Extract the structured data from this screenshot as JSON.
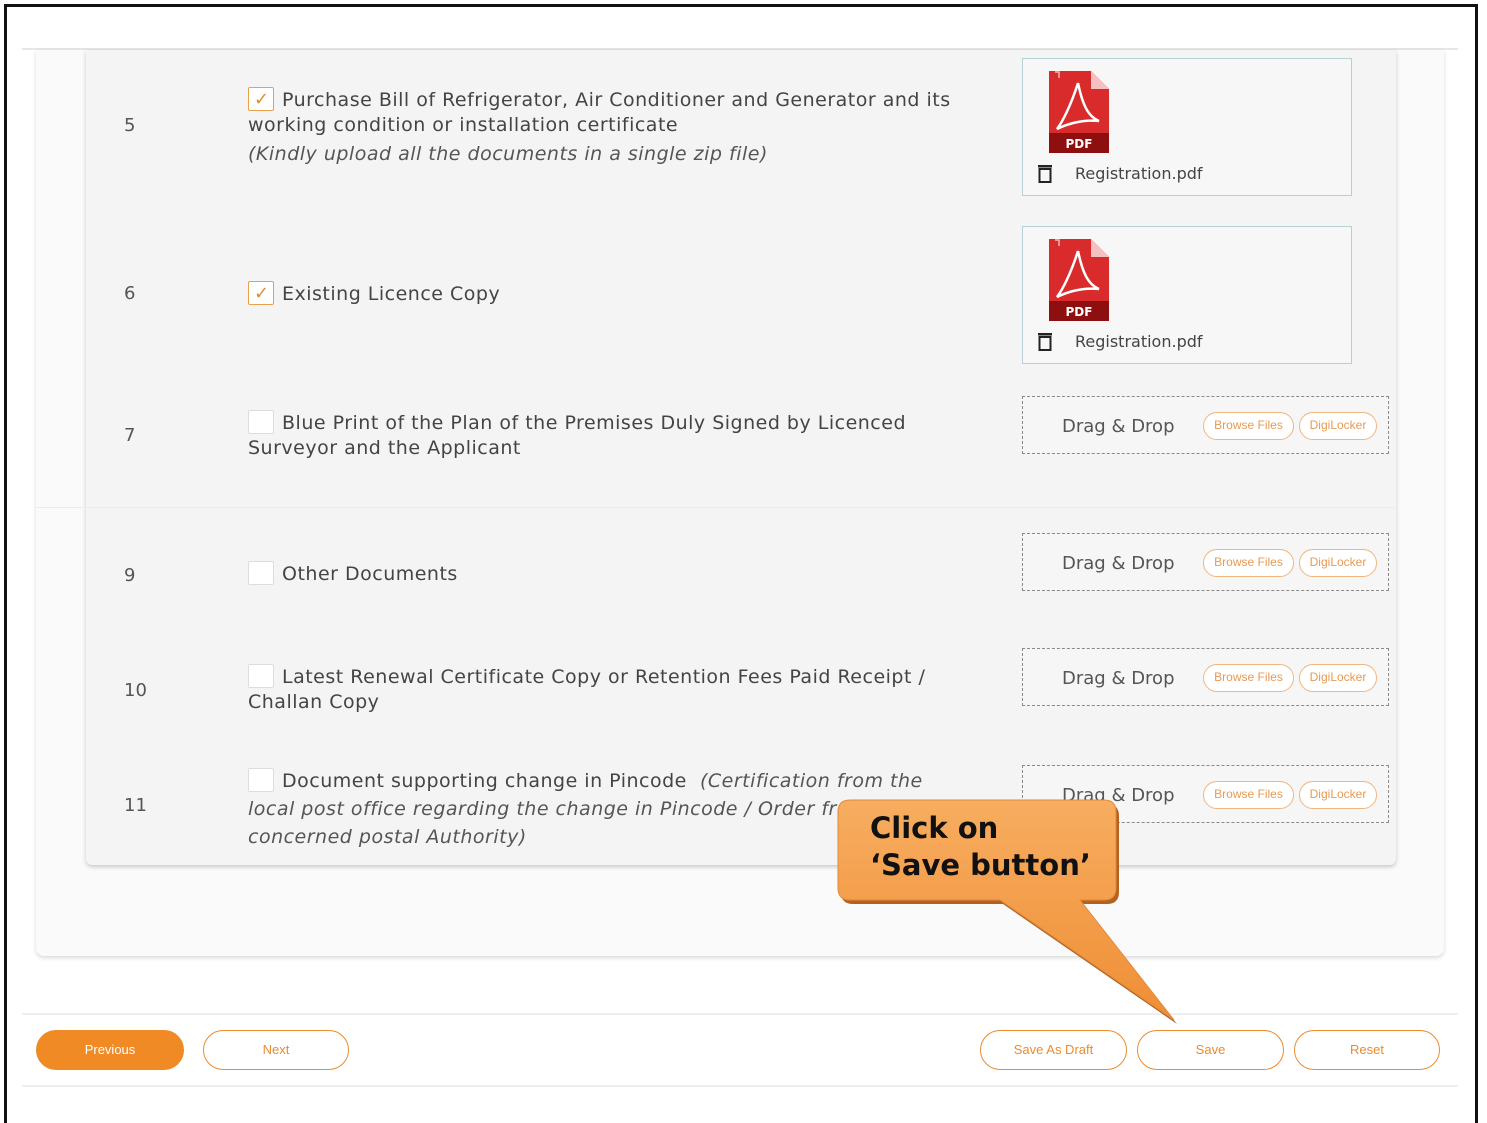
{
  "documents": [
    {
      "number": "5",
      "label": "Purchase Bill of Refrigerator, Air Conditioner and Generator and its working condition or installation certificate",
      "note": "(Kindly upload all the documents in a single zip file)",
      "checked": true,
      "file_name": "Registration.pdf"
    },
    {
      "number": "6",
      "label": "Existing Licence Copy",
      "note": "",
      "checked": true,
      "file_name": "Registration.pdf"
    },
    {
      "number": "7",
      "label": "Blue Print of the Plan of the Premises Duly Signed by Licenced Surveyor and the Applicant",
      "note": "",
      "checked": false
    },
    {
      "number": "9",
      "label": "Other Documents",
      "note": "",
      "checked": false
    },
    {
      "number": "10",
      "label": "Latest Renewal Certificate Copy or Retention Fees Paid Receipt / Challan Copy",
      "note": "",
      "checked": false
    },
    {
      "number": "11",
      "label": "Document supporting change in Pincode",
      "note": "(Certification from the local post office regarding the change in Pincode / Order from the concerned postal Authority)",
      "checked": false
    }
  ],
  "upload": {
    "drag_drop": "Drag & Drop",
    "browse_files": "Browse Files",
    "digilocker": "DigiLocker",
    "pdf_label": "PDF"
  },
  "footer": {
    "previous": "Previous",
    "next": "Next",
    "save_as_draft": "Save As Draft",
    "save": "Save",
    "reset": "Reset"
  },
  "callout": {
    "line1": "Click on",
    "line2": "‘Save button’"
  },
  "colors": {
    "accent": "#f08a25",
    "pill_border": "#f0b67f",
    "callout_fill": "#f39a45",
    "pdf_red": "#d92b2b"
  },
  "icons": {
    "file": "pdf-file-icon",
    "delete": "trash-icon",
    "check": "check-icon"
  }
}
